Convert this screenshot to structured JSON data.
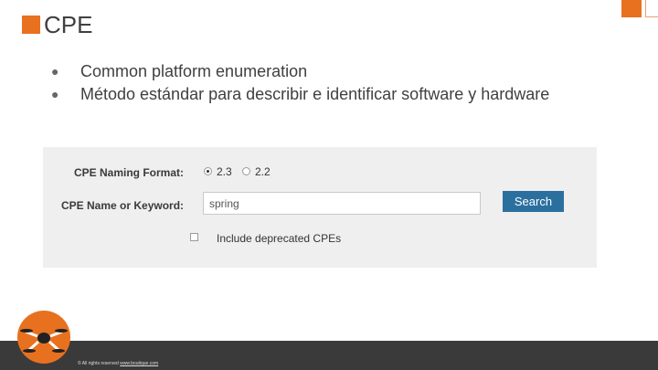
{
  "slide": {
    "title": "CPE",
    "bullets": [
      "Common platform enumeration",
      "Método estándar para describir e identificar software y hardware"
    ]
  },
  "form": {
    "naming_format_label": "CPE Naming Format:",
    "format_options": [
      "2.3",
      "2.2"
    ],
    "selected_format": "2.3",
    "keyword_label": "CPE Name or Keyword:",
    "keyword_value": "spring",
    "search_button": "Search",
    "deprecated_label": "Include deprecated CPEs",
    "deprecated_checked": false
  },
  "footer": {
    "rights_text": "© All rights reserved ",
    "link_text": "www.boutique.com"
  },
  "colors": {
    "accent": "#e8711f",
    "button": "#2b6f9f",
    "footer": "#3a3a3a"
  }
}
